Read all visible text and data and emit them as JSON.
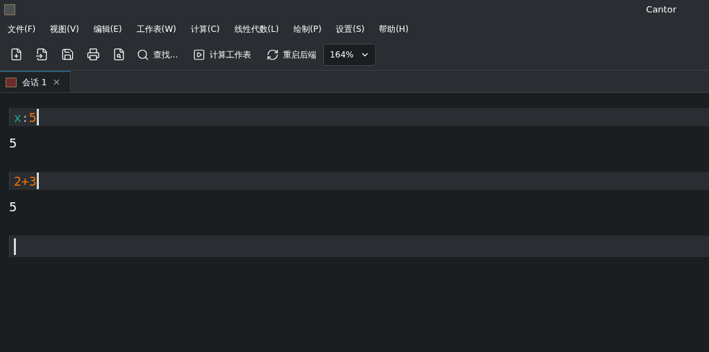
{
  "window": {
    "title": "Cantor"
  },
  "menu": [
    "文件(F)",
    "视图(V)",
    "编辑(E)",
    "工作表(W)",
    "计算(C)",
    "线性代数(L)",
    "绘制(P)",
    "设置(S)",
    "帮助(H)"
  ],
  "toolbar": {
    "find": "查找...",
    "evaluate": "计算工作表",
    "restart": "重启后端",
    "zoom": "164%"
  },
  "tabs": [
    {
      "label": "会话 1",
      "selected": true
    }
  ],
  "entries": [
    {
      "kind": "input",
      "tokens": [
        {
          "text": "x",
          "kind": "variable"
        },
        {
          "text": ":",
          "kind": "operator"
        },
        {
          "text": "5",
          "kind": "number"
        }
      ]
    },
    {
      "kind": "output",
      "text": "5"
    },
    {
      "kind": "input",
      "tokens": [
        {
          "text": "2+3",
          "kind": "number"
        }
      ]
    },
    {
      "kind": "output",
      "text": "5"
    },
    {
      "kind": "input"
    }
  ]
}
